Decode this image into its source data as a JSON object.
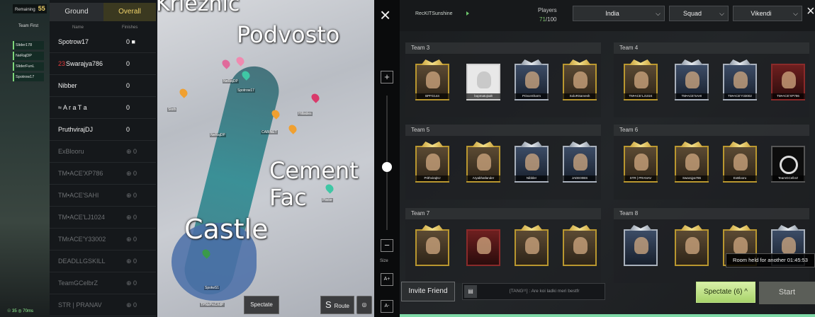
{
  "game": {
    "remaining_label": "Remaining",
    "remaining_count": "55",
    "team_first_label": "Team First",
    "mini_players": [
      "Slider178",
      "NeRajDP",
      "SliderFunL",
      "Spotrow17"
    ],
    "bottom_status": "☉ 35 ◎ 70ms"
  },
  "scoreboard": {
    "tab_ground": "Ground",
    "tab_overall": "Overall",
    "col_name": "Name",
    "col_finishes": "Finishes",
    "rows": [
      {
        "name": "Spotrow17",
        "score": "0 ■",
        "dim": false,
        "rank": ""
      },
      {
        "name": "Swarajya786",
        "score": "0",
        "dim": false,
        "rank": "23"
      },
      {
        "name": "Nibber",
        "score": "0",
        "dim": false,
        "rank": ""
      },
      {
        "name": "≈ A r a T a",
        "score": "0",
        "dim": false,
        "rank": ""
      },
      {
        "name": "PruthvirajDJ",
        "score": "0",
        "dim": false,
        "rank": ""
      },
      {
        "name": "ExBlooru",
        "score": "⊕ 0",
        "dim": true,
        "rank": ""
      },
      {
        "name": "TM•ACE'XP786",
        "score": "⊕ 0",
        "dim": true,
        "rank": ""
      },
      {
        "name": "TM•ACE'SAHI",
        "score": "⊕ 0",
        "dim": true,
        "rank": ""
      },
      {
        "name": "TM•ACE'LJ1024",
        "score": "⊕ 0",
        "dim": true,
        "rank": ""
      },
      {
        "name": "TMrACE'Y33002",
        "score": "⊕ 0",
        "dim": true,
        "rank": ""
      },
      {
        "name": "DEADLLGSKILL",
        "score": "⊕ 0",
        "dim": true,
        "rank": ""
      },
      {
        "name": "TeamGCelbrZ",
        "score": "⊕ 0",
        "dim": true,
        "rank": ""
      },
      {
        "name": "STR | PRANAV",
        "score": "⊕ 0",
        "dim": true,
        "rank": ""
      }
    ]
  },
  "map": {
    "labels": [
      "Krieznic",
      "Podvosto",
      "Cement Fac",
      "Castle"
    ],
    "small_labels": [
      "Sloth",
      "NeRajDP",
      "Spotrow17",
      "Hillsides",
      "CABINET",
      "NeRajDP",
      "Pliolor",
      "TPNsPro1XdP",
      "SpotwS1"
    ],
    "spectate_button": "Spectate",
    "route_button": "Route",
    "route_icon": "S"
  },
  "zoom": {
    "plus": "+",
    "minus": "−",
    "label_small": "Size",
    "a_plus": "A+",
    "a_minus": "A-"
  },
  "lobby": {
    "room_name": "RecKITSunshine",
    "players_label": "Players",
    "players_current": "71",
    "players_total": "/100",
    "region": "India",
    "mode": "Squad",
    "map": "Vikendi",
    "close_icon": "×",
    "dropdown_arrow": "⌵",
    "teams": [
      {
        "label": "Team 3",
        "players": [
          {
            "name": "BPFG144",
            "style": "gold"
          },
          {
            "name": "bopmatojsalt",
            "style": "plain"
          },
          {
            "name": "PrinceSharm",
            "style": "silver"
          },
          {
            "name": "SoloRSarvesh",
            "style": "gold"
          }
        ]
      },
      {
        "label": "Team 4",
        "players": [
          {
            "name": "TM•ACE'LJ1024",
            "style": "gold"
          },
          {
            "name": "TM•ACE'SAHI",
            "style": "silver"
          },
          {
            "name": "TM•ACE'Y33002",
            "style": "silver"
          },
          {
            "name": "TM•ACE'XP786",
            "style": "red"
          }
        ]
      },
      {
        "label": "Team 5",
        "players": [
          {
            "name": "PrithvirajDJ",
            "style": "gold"
          },
          {
            "name": "Aryabhatlander",
            "style": "gold"
          },
          {
            "name": "Nibbler",
            "style": "silver"
          },
          {
            "name": "JADE00BS",
            "style": "silver"
          }
        ]
      },
      {
        "label": "Team 6",
        "players": [
          {
            "name": "STR | PRANAV",
            "style": "gold"
          },
          {
            "name": "Swarajya786",
            "style": "gold"
          },
          {
            "name": "ExBlooru",
            "style": "gold"
          },
          {
            "name": "TeamGCelbrZ",
            "style": "dark"
          }
        ]
      },
      {
        "label": "Team 7",
        "players": [
          {
            "name": "",
            "style": "gold"
          },
          {
            "name": "",
            "style": "red"
          },
          {
            "name": "",
            "style": "gold"
          },
          {
            "name": "",
            "style": "gold"
          }
        ]
      },
      {
        "label": "Team 8",
        "players": [
          {
            "name": "",
            "style": "silver"
          },
          {
            "name": "",
            "style": "gold"
          },
          {
            "name": "",
            "style": "gold"
          },
          {
            "name": "",
            "style": "silver"
          }
        ]
      }
    ],
    "room_held": "Room held for another 01:45:53",
    "invite_button": "Invite Friend",
    "chat_icon": "▤",
    "chat_preview": "[TANG¹¹] : Are koi ladki meri bestfr",
    "spectate_button": "Spectate (6) ^",
    "start_button": "Start"
  }
}
